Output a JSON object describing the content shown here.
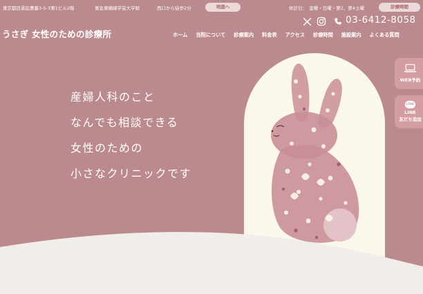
{
  "topbar": {
    "address": "東京都目黒区鷹番3-5-3第1ビル2階",
    "station": "東急東横線学芸大学駅",
    "walk": "西口から徒歩2分",
    "map_button": "地図へ",
    "closed_days": "休診日：　金曜・日曜・第2、第4土曜",
    "hours_button": "診療時間"
  },
  "header": {
    "logo": "うさぎ 女性のための診療所",
    "phone": "03-6412-8058",
    "icons": [
      "x-icon",
      "instagram-icon",
      "phone-icon"
    ]
  },
  "nav": {
    "items": [
      "ホーム",
      "当院について",
      "診療案内",
      "料金表",
      "アクセス",
      "診療時間",
      "施設案内",
      "よくある質問"
    ]
  },
  "hero": {
    "lines": [
      "産婦人科のこと",
      "なんでも相談できる",
      "女性のための",
      "小さなクリニックです"
    ]
  },
  "side": {
    "web_label": "WEB予約",
    "line_badge": "LINE",
    "line_label": "LINE",
    "line_sub": "友だち追加"
  },
  "colors": {
    "background": "#bb8a8e",
    "arch": "#fbf7ea",
    "rabbit": "#c98e98",
    "pill": "#ecd9d9",
    "side_tab": "#d49da2",
    "hill": "#f1ede9"
  }
}
